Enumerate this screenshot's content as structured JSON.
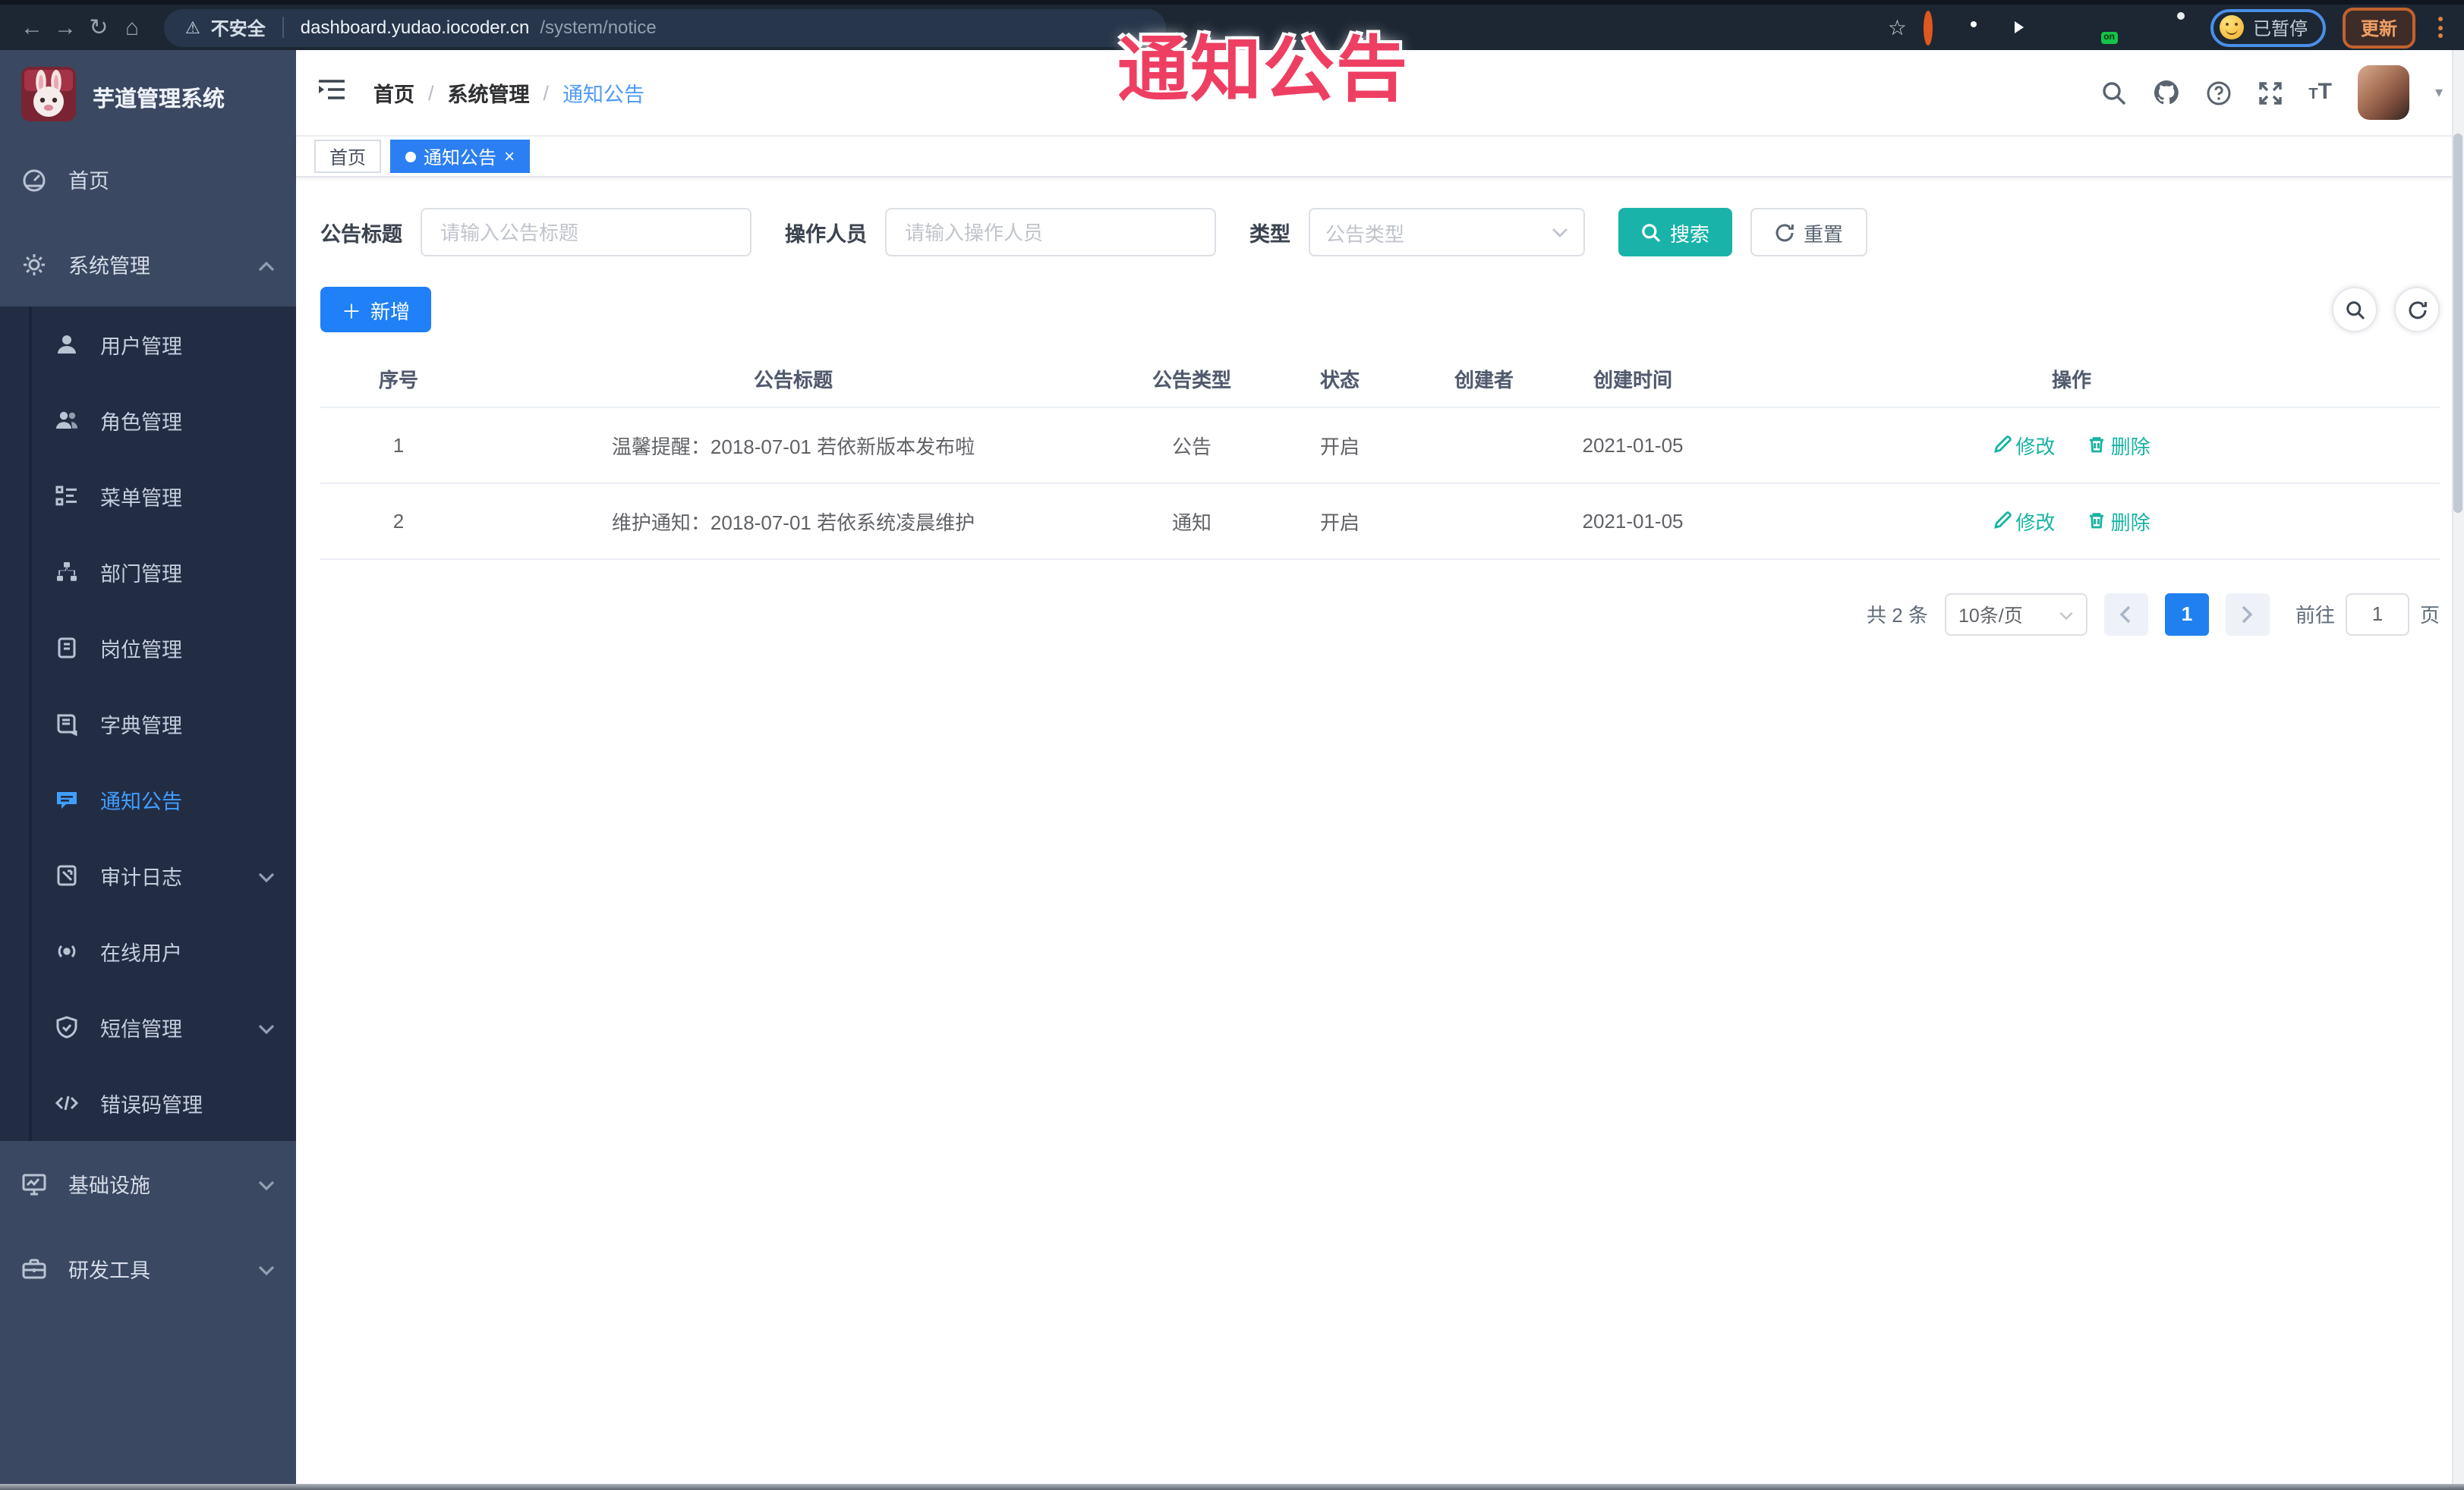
{
  "browser": {
    "security_label": "不安全",
    "url_host": "dashboard.yudao.iocoder.cn",
    "url_path": "/system/notice",
    "bookmark_star": "☆",
    "paused_label": "已暂停",
    "update_label": "更新",
    "extension_on_badge": "on"
  },
  "icons": {
    "back": "←",
    "forward": "→",
    "reload": "↻",
    "home": "⌂",
    "warning": "⚠",
    "caret_down": "▾",
    "close": "×",
    "plus": "＋",
    "breadcrumb_sep": "/"
  },
  "overlay_text": "通知公告",
  "sidebar": {
    "logo_title": "芋道管理系统",
    "items": [
      {
        "label": "首页"
      },
      {
        "label": "系统管理",
        "state": "expanded"
      },
      {
        "label": "用户管理"
      },
      {
        "label": "角色管理"
      },
      {
        "label": "菜单管理"
      },
      {
        "label": "部门管理"
      },
      {
        "label": "岗位管理"
      },
      {
        "label": "字典管理"
      },
      {
        "label": "通知公告",
        "state": "active"
      },
      {
        "label": "审计日志",
        "state": "collapsed"
      },
      {
        "label": "在线用户"
      },
      {
        "label": "短信管理",
        "state": "collapsed"
      },
      {
        "label": "错误码管理"
      },
      {
        "label": "基础设施",
        "state": "collapsed"
      },
      {
        "label": "研发工具",
        "state": "collapsed"
      }
    ]
  },
  "navbar": {
    "breadcrumb": [
      "首页",
      "系统管理",
      "通知公告"
    ]
  },
  "tags": [
    {
      "label": "首页"
    },
    {
      "label": "通知公告"
    }
  ],
  "filters": {
    "title_label": "公告标题",
    "title_placeholder": "请输入公告标题",
    "operator_label": "操作人员",
    "operator_placeholder": "请输入操作人员",
    "type_label": "类型",
    "type_placeholder": "公告类型",
    "search_label": "搜索",
    "reset_label": "重置"
  },
  "toolbar": {
    "add_label": "新增"
  },
  "table": {
    "headers": [
      "序号",
      "公告标题",
      "公告类型",
      "状态",
      "创建者",
      "创建时间",
      "操作"
    ],
    "rows": [
      {
        "no": "1",
        "title": "温馨提醒：2018-07-01 若依新版本发布啦",
        "type": "公告",
        "status": "开启",
        "creator": "",
        "created": "2021-01-05",
        "edit": "修改",
        "delete": "删除"
      },
      {
        "no": "2",
        "title": "维护通知：2018-07-01 若依系统凌晨维护",
        "type": "通知",
        "status": "开启",
        "creator": "",
        "created": "2021-01-05",
        "edit": "修改",
        "delete": "删除"
      }
    ]
  },
  "pagination": {
    "total": "共 2 条",
    "page_size": "10条/页",
    "current_page": "1",
    "goto_label": "前往",
    "goto_value": "1",
    "page_unit": "页"
  },
  "colors": {
    "primary_blue": "#2080f0",
    "search_teal": "#1ab3a9",
    "sidebar_active": "#409eff",
    "action_teal": "#17b3a3",
    "overlay_red": "#ee3f63"
  }
}
